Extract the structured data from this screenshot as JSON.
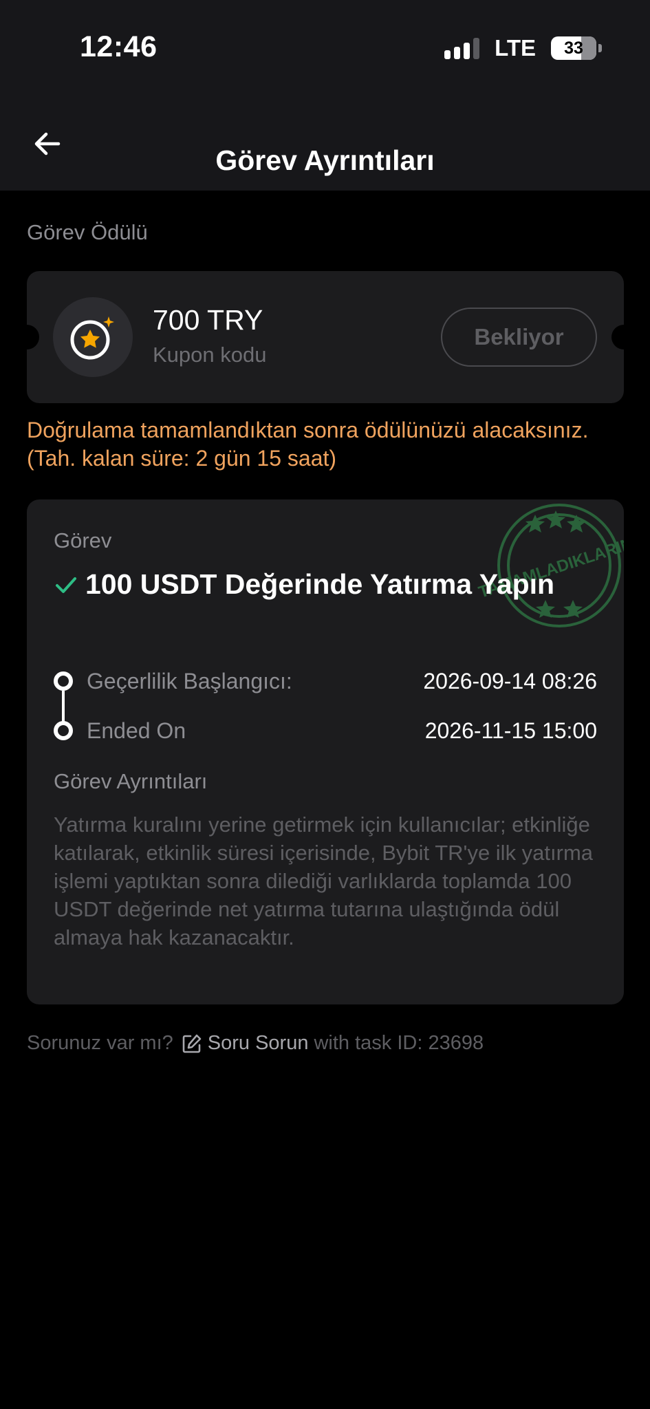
{
  "status_bar": {
    "time": "12:46",
    "network": "LTE",
    "battery": "33"
  },
  "header": {
    "title": "Görev Ayrıntıları"
  },
  "reward": {
    "section_label": "Görev Ödülü",
    "amount": "700 TRY",
    "type": "Kupon kodu",
    "status": "Bekliyor",
    "notice": "Doğrulama tamamlandıktan sonra ödülünüzü alacaksınız. (Tah. kalan süre: 2 gün 15 saat)"
  },
  "task": {
    "label": "Görev",
    "title": "100 USDT Değerinde Yatırma Yapın",
    "stamp_text": "TAMAMLADIKLARINIZ",
    "start_label": "Geçerlilik Başlangıcı:",
    "start_value": "2026-09-14 08:26",
    "end_label": "Ended On",
    "end_value": "2026-11-15 15:00",
    "details_label": "Görev Ayrıntıları",
    "details_text": "Yatırma kuralını yerine getirmek için kullanıcılar; etkinliğe katılarak, etkinlik süresi içerisinde, Bybit TR'ye ilk yatırma işlemi yaptıktan sonra dilediği varlıklarda toplamda 100 USDT değerinde net yatırma tutarına ulaştığında ödül almaya hak kazanacaktır."
  },
  "footer": {
    "question": "Sorunuz var mı?",
    "ask_label": "Soru Sorun",
    "suffix": "with task ID: 23698"
  },
  "colors": {
    "accent_orange": "#f0a35e",
    "check_green": "#2ebd85",
    "star_gold": "#f7a600"
  },
  "icons": [
    "back-arrow-icon",
    "star-coin-icon",
    "check-icon",
    "edit-icon"
  ]
}
